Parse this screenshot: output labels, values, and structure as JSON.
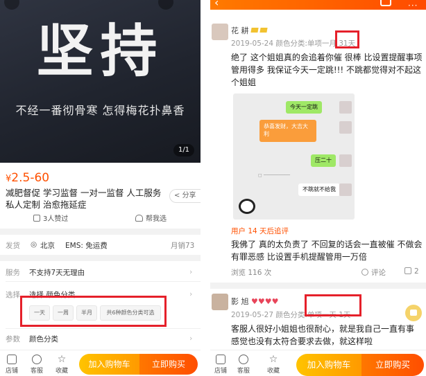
{
  "left": {
    "hero": {
      "big_text": "坚持",
      "sub_text": "不经一番彻骨寒 怎得梅花扑鼻香",
      "indicator": "1/1"
    },
    "price": {
      "currency": "¥",
      "range": "2.5-60"
    },
    "title": "减肥督促 学习监督 一对一监督 人工服务 私人定制 治愈拖延症",
    "share_label": "分享",
    "likes_text": "3人赞过",
    "help_text": "帮我选",
    "shipping": {
      "label": "发货",
      "location": "北京",
      "fee": "EMS: 免运费",
      "sales": "月销73"
    },
    "service": {
      "label": "服务",
      "value": "不支持7天无理由"
    },
    "select": {
      "label": "选择",
      "value": "选择 颜色分类",
      "options": [
        "一天",
        "一周",
        "半月",
        "共6种颜色分类可选"
      ]
    },
    "params": {
      "label": "参数",
      "value": "颜色分类"
    },
    "bottom": {
      "shop": "店铺",
      "service": "客服",
      "favorite": "收藏",
      "add_to_cart": "加入购物车",
      "buy_now": "立即购买"
    }
  },
  "right": {
    "review1": {
      "user": "花 耕",
      "meta_prefix": "2019-05-24 颜色分类:单项一月",
      "meta_highlight": "31天",
      "text": "绝了 这个姐姐真的会追着你催 很棒 比设置提醒事项管用得多 我保证今天一定跳!!! 不跳都觉得对不起这个姐姐",
      "chat": {
        "msg1": "今天一定跳",
        "red_packet": "恭喜发财，大吉大利",
        "msg2": "压二十",
        "msg3": "不跳就不给我"
      },
      "followup": "用户 14 天后追评",
      "followup_text": "我佛了 真的太负责了 不回复的话会一直被催 不做会有罪恶感 比设置手机提醒管用一万倍",
      "views": "浏览 116 次",
      "comment": "评论",
      "likes": "2"
    },
    "review2": {
      "user": "影 旭",
      "meta_prefix": "2019-05-27 颜色分类:单项一天",
      "meta_highlight": "1天",
      "text": "客服人很好小姐姐也很耐心，就是我自己一直有事感觉也没有太符合要求去做，就这样啦"
    },
    "bottom": {
      "shop": "店铺",
      "service": "客服",
      "favorite": "收藏",
      "add_to_cart": "加入购物车",
      "buy_now": "立即购买"
    }
  }
}
